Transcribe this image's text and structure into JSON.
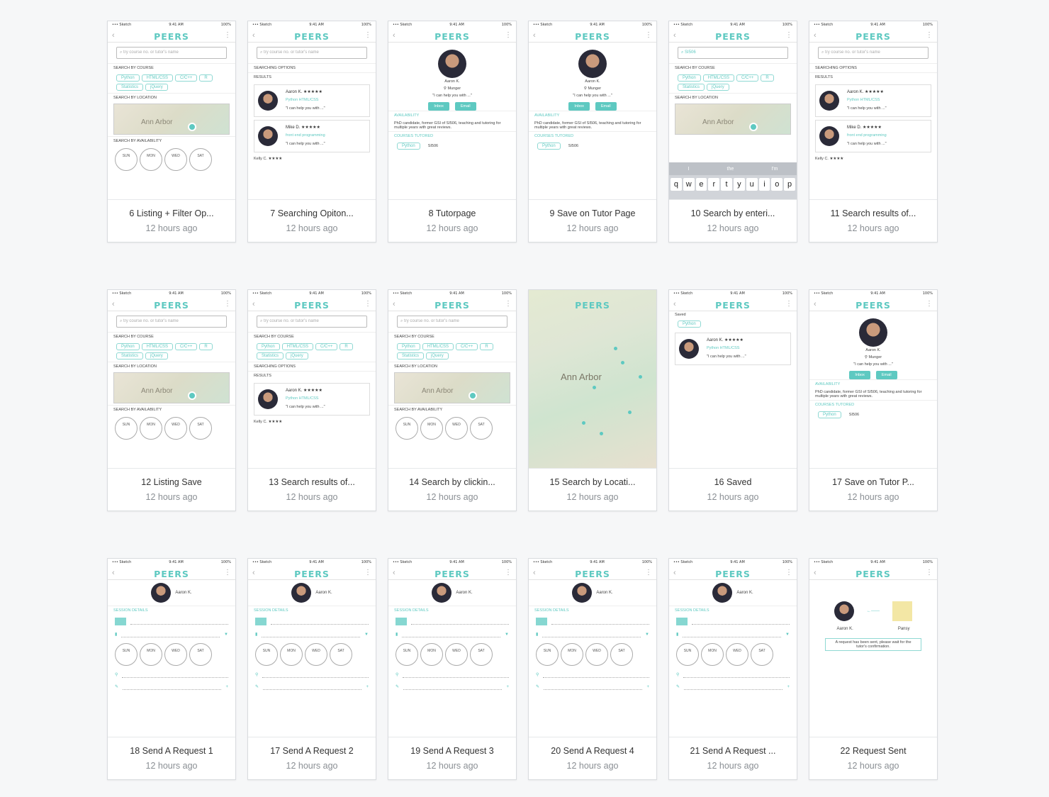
{
  "app": {
    "brand": "PEERS",
    "status_left": "••• Sketch",
    "status_time": "9:41 AM",
    "status_right": "100%"
  },
  "cards": [
    {
      "title": "6 Listing + Filter Op...",
      "time": "12 hours ago",
      "kind": "listing"
    },
    {
      "title": "7 Searching Opiton...",
      "time": "12 hours ago",
      "kind": "results"
    },
    {
      "title": "8 Tutorpage",
      "time": "12 hours ago",
      "kind": "tutor"
    },
    {
      "title": "9 Save on Tutor Page",
      "time": "12 hours ago",
      "kind": "tutor"
    },
    {
      "title": "10 Search by enteri...",
      "time": "12 hours ago",
      "kind": "keyboard"
    },
    {
      "title": "11 Search results of...",
      "time": "12 hours ago",
      "kind": "results"
    },
    {
      "title": "12 Listing Save",
      "time": "12 hours ago",
      "kind": "listing"
    },
    {
      "title": "13 Search results of...",
      "time": "12 hours ago",
      "kind": "results2"
    },
    {
      "title": "14 Search by clickin...",
      "time": "12 hours ago",
      "kind": "listing"
    },
    {
      "title": "15 Search by Locati...",
      "time": "12 hours ago",
      "kind": "map"
    },
    {
      "title": "16 Saved",
      "time": "12 hours ago",
      "kind": "saved"
    },
    {
      "title": "17 Save on Tutor P...",
      "time": "12 hours ago",
      "kind": "tutor"
    },
    {
      "title": "18 Send A Request 1",
      "time": "12 hours ago",
      "kind": "request"
    },
    {
      "title": "17 Send A Request 2",
      "time": "12 hours ago",
      "kind": "request"
    },
    {
      "title": "19 Send A Request 3",
      "time": "12 hours ago",
      "kind": "request"
    },
    {
      "title": "20 Send A Request 4",
      "time": "12 hours ago",
      "kind": "request"
    },
    {
      "title": "21 Send A Request ...",
      "time": "12 hours ago",
      "kind": "request"
    },
    {
      "title": "22 Request Sent",
      "time": "12 hours ago",
      "kind": "sent"
    }
  ],
  "mock": {
    "search_placeholder": "try course no. or tutor's name",
    "search_value": "SI506",
    "search_by_course": "SEARCH BY COURSE",
    "search_by_location": "SEARCH BY LOCATION",
    "search_by_availability": "SEARCH BY AVAILABILITY",
    "searching_options": "SEARCHING OPTIONS",
    "results": "RESULTS",
    "courses": [
      "Python",
      "HTML/CSS",
      "C/C++",
      "R",
      "Statistics",
      "jQuery"
    ],
    "map_label": "Ann Arbor",
    "days": [
      "SUN",
      "MON",
      "WED",
      "SAT"
    ],
    "tutor_a": "Aaron K.",
    "tutor_m": "Mike D.",
    "tutor_k": "Kelly C.",
    "tagline": "\"I can help you with ...\"",
    "location": "Munger",
    "inbox": "Inbox",
    "email": "Email",
    "availability": "AVAILABILITY",
    "bio": "PhD candidate, former GSI of SI506, teaching and tutoring for multiple years with great reviews.",
    "courses_tutored": "COURSES TUTORED",
    "session_details": "SESSION DETAILS",
    "saved": "Saved",
    "request_sent": "A request has been sent, please wait for the tutor's confirmation.",
    "pansy": "Pansy",
    "keys": [
      "q",
      "w",
      "e",
      "r",
      "t",
      "y",
      "u",
      "i",
      "o",
      "p"
    ],
    "suggest": [
      "I",
      "the",
      "I'm"
    ]
  }
}
